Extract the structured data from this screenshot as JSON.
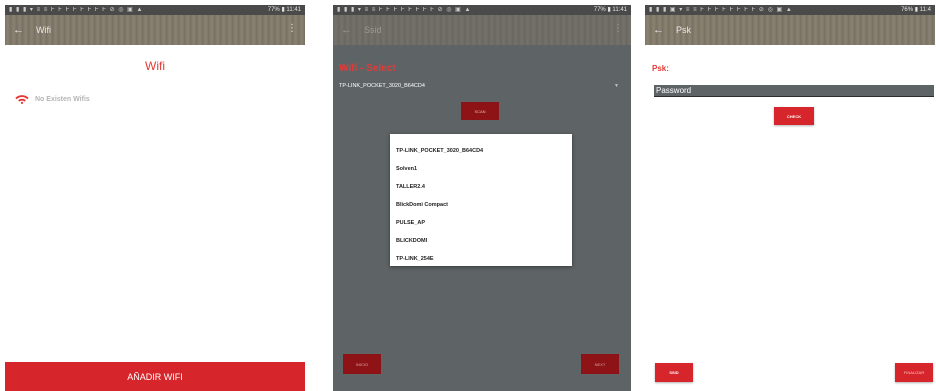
{
  "screen1": {
    "status": {
      "icons": "▮ ▮ ▮ ▾ ≡ ≡ F F F F F F F F ⊘ ◎ ▣ ▲",
      "battery": "77%",
      "time": "11:41"
    },
    "appbar": {
      "back_icon": "arrow-left-icon",
      "title": "Wifi"
    },
    "heading": "Wifi",
    "empty_text": "No Existen Wifis",
    "add_button": "AÑADIR WIFI",
    "accent": "#d6262b"
  },
  "screen2": {
    "status": {
      "icons": "▮ ▮ ▮ ▾ ≡ ≡ F F F F F F F F ⊘ ◎ ▣ ▲",
      "battery": "77%",
      "time": "11:41"
    },
    "appbar": {
      "back_icon": "arrow-left-icon",
      "title": "Ssid"
    },
    "heading": "Wifi - Select",
    "selected_network": "TP-LINK_POCKET_3020_B64CD4",
    "scan_button": "SCAN",
    "networks": [
      "TP-LINK_POCKET_3020_B64CD4",
      "Solven1",
      "TALLER2.4",
      "BlickDomi Compact",
      "PULSE_AP",
      "BLICKDOMI",
      "TP-LINK_254E"
    ],
    "inicio_button": "INICIO",
    "next_button": "NEXT"
  },
  "screen3": {
    "status": {
      "icons": "▮ ▮ ▮ ▣ ▾ ≡ ≡ F F F F F F F F ⊘ ◎ ▣ ▲",
      "battery": "76%",
      "time": "11:4"
    },
    "appbar": {
      "back_icon": "arrow-left-icon",
      "title": "Psk"
    },
    "label": "Psk:",
    "password_placeholder": "Password",
    "check_button": "CHECK",
    "ssid_button": "SSID",
    "finalizar_button": "FINALIZAR"
  }
}
